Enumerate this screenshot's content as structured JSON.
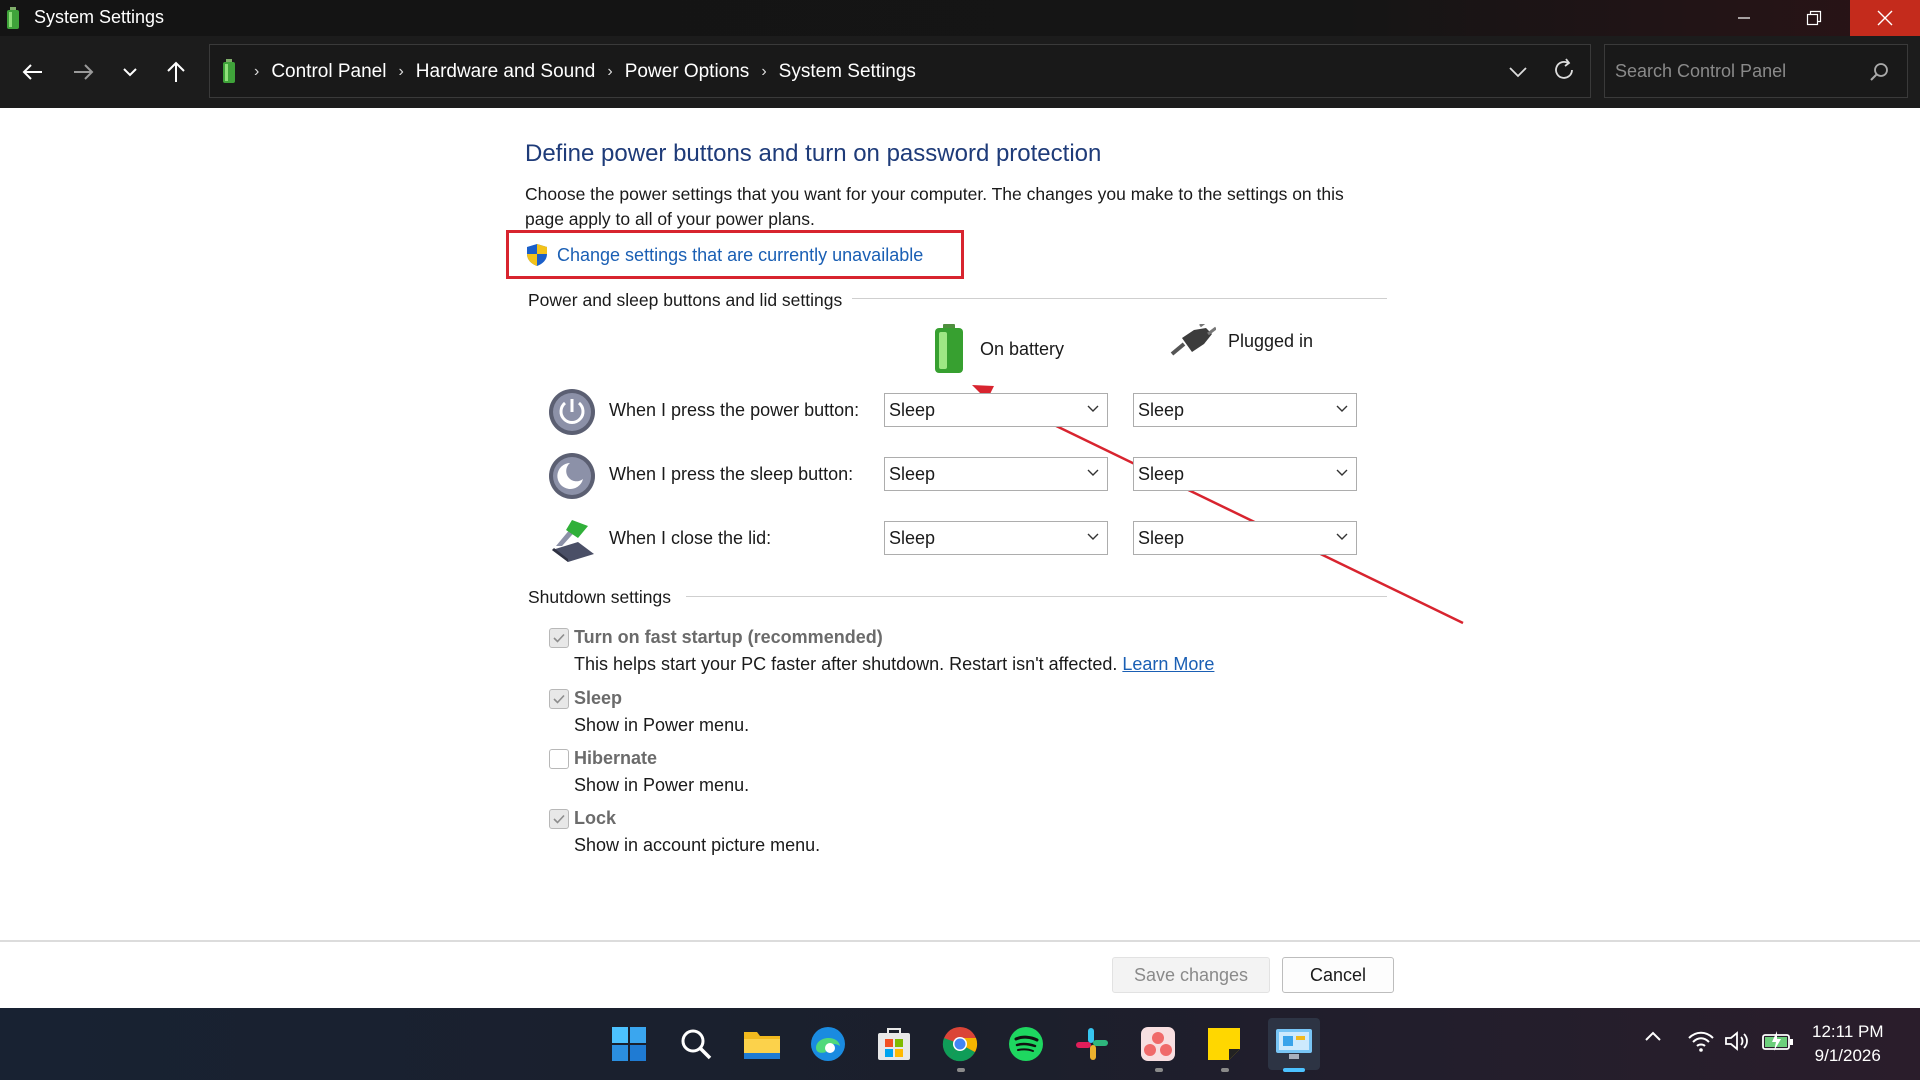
{
  "window": {
    "title": "System Settings"
  },
  "address": {
    "crumbs": [
      "Control Panel",
      "Hardware and Sound",
      "Power Options",
      "System Settings"
    ],
    "search_placeholder": "Search Control Panel"
  },
  "page": {
    "heading": "Define power buttons and turn on password protection",
    "description": "Choose the power settings that you want for your computer. The changes you make to the settings on this page apply to all of your power plans.",
    "change_link": "Change settings that are currently unavailable"
  },
  "power_section": {
    "title": "Power and sleep buttons and lid settings",
    "col_battery": "On battery",
    "col_plugged": "Plugged in",
    "rows": [
      {
        "label": "When I press the power button:",
        "battery": "Sleep",
        "plugged": "Sleep"
      },
      {
        "label": "When I press the sleep button:",
        "battery": "Sleep",
        "plugged": "Sleep"
      },
      {
        "label": "When I close the lid:",
        "battery": "Sleep",
        "plugged": "Sleep"
      }
    ]
  },
  "shutdown_section": {
    "title": "Shutdown settings",
    "items": [
      {
        "title": "Turn on fast startup (recommended)",
        "desc": "This helps start your PC faster after shutdown. Restart isn't affected.",
        "link": "Learn More",
        "checked": true
      },
      {
        "title": "Sleep",
        "desc": "Show in Power menu.",
        "checked": true
      },
      {
        "title": "Hibernate",
        "desc": "Show in Power menu.",
        "checked": false
      },
      {
        "title": "Lock",
        "desc": "Show in account picture menu.",
        "checked": true
      }
    ]
  },
  "footer": {
    "save": "Save changes",
    "cancel": "Cancel"
  },
  "taskbar": {
    "apps": [
      "start-icon",
      "search-icon",
      "file-explorer-icon",
      "edge-icon",
      "store-icon",
      "chrome-icon",
      "spotify-icon",
      "slack-icon",
      "asana-icon",
      "sticky-notes-icon",
      "control-panel-icon"
    ],
    "time": "12:11 PM",
    "date": "9/1/2026"
  },
  "colors": {
    "accent_link": "#1a5fb4",
    "heading": "#1e3b79",
    "highlight": "#d8242f",
    "close": "#c42b1c"
  }
}
